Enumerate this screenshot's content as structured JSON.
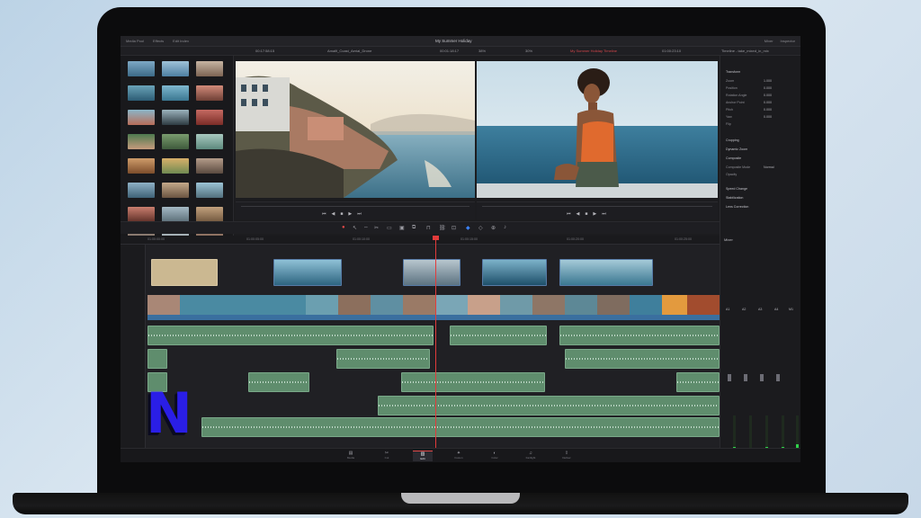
{
  "app": {
    "project_title": "My Summer Holiday"
  },
  "topbar": {
    "left_items": [
      "Media Pool",
      "Effects",
      "Edit Index"
    ],
    "right_items": [
      "Mixer",
      "Inspector"
    ]
  },
  "subbar": {
    "clip_name": "Amalfi_Coast_Aerial_Drone",
    "timecode_source": "00:17:58:15",
    "timecode_program": "00:01:18:17",
    "timeline_name": "My Summer Holiday Timeline",
    "zoom_left": "38%",
    "zoom_right": "30%",
    "timecode_end": "01:00:23:10",
    "inspector_clip": "Timeline - take_mixed_in_mix"
  },
  "inspector": {
    "sections": [
      "Transform",
      "Cropping",
      "Dynamic Zoom",
      "Composite",
      "Speed Change",
      "Stabilization",
      "Lens Correction"
    ],
    "transform_fields": [
      {
        "label": "Zoom",
        "value": "1.000"
      },
      {
        "label": "Position",
        "value": "0.000"
      },
      {
        "label": "Rotation Angle",
        "value": "0.000"
      },
      {
        "label": "Anchor Point",
        "value": "0.000"
      },
      {
        "label": "Pitch",
        "value": "0.000"
      },
      {
        "label": "Yaw",
        "value": "0.000"
      },
      {
        "label": "Flip",
        "value": ""
      }
    ],
    "composite_mode_label": "Composite Mode",
    "composite_mode_value": "Normal",
    "opacity_label": "Opacity"
  },
  "ruler": {
    "ticks": [
      "01:00:00:00",
      "01:00:05:00",
      "01:00:10:00",
      "01:00:15:00",
      "01:00:20:00",
      "01:00:25:00"
    ]
  },
  "mixer": {
    "title": "Mixer",
    "channels": [
      "A1",
      "A2",
      "A3",
      "A4",
      "M1"
    ],
    "levels": [
      0.5,
      0.48,
      0.5,
      0.5,
      0.55
    ]
  },
  "pages": [
    {
      "label": "Media",
      "icon": "media-icon"
    },
    {
      "label": "Cut",
      "icon": "cut-icon"
    },
    {
      "label": "Edit",
      "icon": "edit-icon"
    },
    {
      "label": "Fusion",
      "icon": "fusion-icon"
    },
    {
      "label": "Color",
      "icon": "color-icon"
    },
    {
      "label": "Fairlight",
      "icon": "fairlight-icon"
    },
    {
      "label": "Deliver",
      "icon": "deliver-icon"
    }
  ],
  "active_page": "Edit",
  "colors": {
    "accent": "#e04848",
    "audio_clip": "#5f8d6d",
    "video_clip": "#2f4a6a",
    "meter": "#2fd14a",
    "logo": "#2a1ee6"
  },
  "logo_text": "N"
}
